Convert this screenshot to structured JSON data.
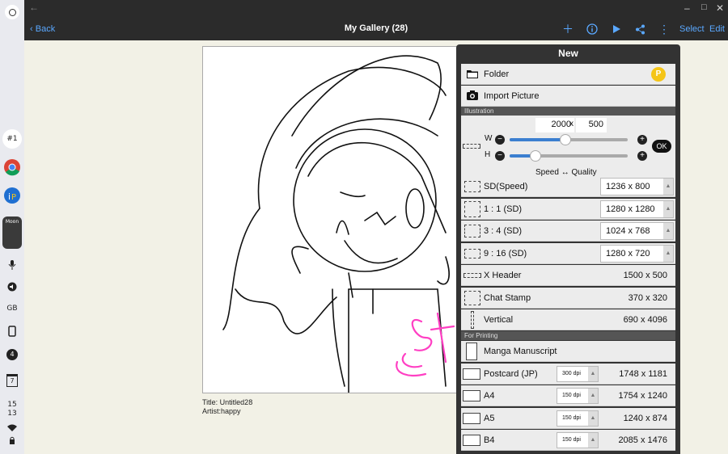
{
  "shelf": {
    "items": [
      "#1",
      "GB",
      "4",
      "7"
    ],
    "time": [
      "15",
      "13"
    ],
    "moon_label": "Moon"
  },
  "window": {
    "back_arrow": "←",
    "minimize": "–",
    "maximize": "□",
    "close": "✕"
  },
  "appbar": {
    "back_label": "Back",
    "title": "My Gallery (28)",
    "select_label": "Select",
    "edit_label": "Edit",
    "icons": [
      "plus-icon",
      "info-icon",
      "play-icon",
      "share-icon",
      "more-icon"
    ]
  },
  "artwork": {
    "title_line": "Title: Untitled28",
    "artist_line": "Artist:happy"
  },
  "panel": {
    "title": "New",
    "folder_label": "Folder",
    "folder_badge": "P",
    "import_label": "Import Picture",
    "illustration_section": "Illustration",
    "custom": {
      "width": "2000",
      "x": "x",
      "height": "500",
      "w_label": "W",
      "h_label": "H",
      "ok_label": "OK",
      "hint": "Speed ↔ Quality",
      "w_level": 0.47,
      "h_level": 0.22
    },
    "sizes": [
      {
        "label": "SD(Speed)",
        "value": "1236 x 800",
        "field": true
      },
      {
        "label": "1 : 1 (SD)",
        "value": "1280 x 1280",
        "field": true
      },
      {
        "label": "3 : 4 (SD)",
        "value": "1024 x 768",
        "field": true
      },
      {
        "label": "9 : 16 (SD)",
        "value": "1280 x 720",
        "field": true
      },
      {
        "label": "X Header",
        "value": "1500 x 500",
        "field": false
      },
      {
        "label": "Chat Stamp",
        "value": "370 x 320",
        "field": false
      },
      {
        "label": "Vertical",
        "value": "690 x 4096",
        "field": false
      }
    ],
    "printing_section": "For Printing",
    "print_sizes": [
      {
        "label": "Manga Manuscript",
        "dpi": "",
        "value": ""
      },
      {
        "label": "Postcard (JP)",
        "dpi": "300 dpi",
        "value": "1748 x 1181"
      },
      {
        "label": "A4",
        "dpi": "150 dpi",
        "value": "1754 x 1240"
      },
      {
        "label": "A5",
        "dpi": "150 dpi",
        "value": "1240 x 874"
      },
      {
        "label": "B4",
        "dpi": "150 dpi",
        "value": "2085 x 1476"
      }
    ]
  },
  "colors": {
    "accent": "#5aa8ff",
    "slider": "#3b7fd0",
    "badge": "#f5c518",
    "sticker": "#ff3fc3"
  }
}
